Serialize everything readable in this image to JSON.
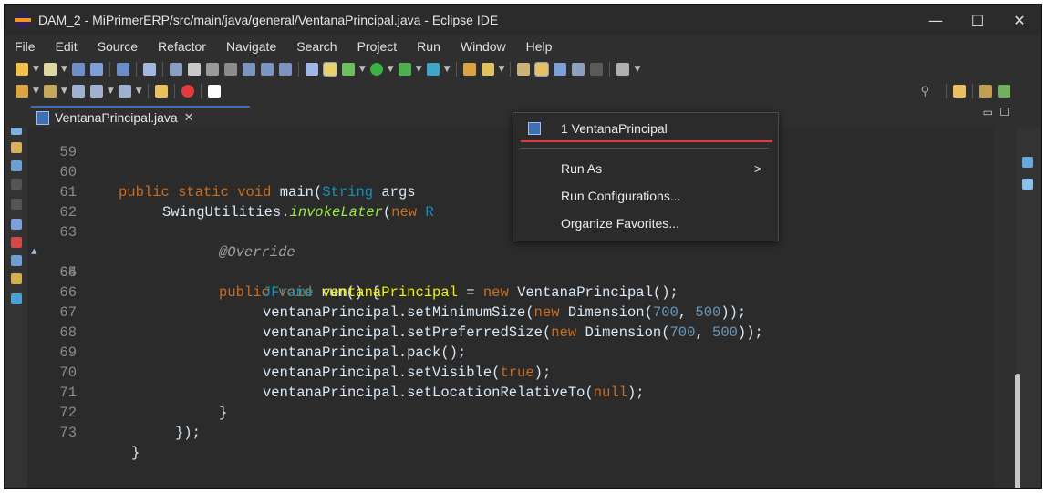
{
  "window": {
    "title": "DAM_2 - MiPrimerERP/src/main/java/general/VentanaPrincipal.java - Eclipse IDE",
    "minimize": "—",
    "maximize": "☐",
    "close": "✕"
  },
  "menubar": [
    "File",
    "Edit",
    "Source",
    "Refactor",
    "Navigate",
    "Search",
    "Project",
    "Run",
    "Window",
    "Help"
  ],
  "editor_tab": {
    "label": "VentanaPrincipal.java",
    "close": "✕"
  },
  "dropdown": {
    "recent_item": "1 VentanaPrincipal",
    "run_as": "Run As",
    "run_as_arrow": ">",
    "run_configurations": "Run Configurations...",
    "organize_favorites": "Organize Favorites..."
  },
  "code_lines": [
    {
      "num": "59",
      "code": ""
    },
    {
      "num": "60",
      "code": "public static void main(String args"
    },
    {
      "num": "61",
      "code": "SwingUtilities.invokeLater(new R"
    },
    {
      "num": "62",
      "code": ""
    },
    {
      "num": "63",
      "code": "@Override"
    },
    {
      "num": "64",
      "code": "public void run() {"
    },
    {
      "num": "65",
      "code": "JFrame ventanaPrincipal = new VentanaPrincipal();"
    },
    {
      "num": "66",
      "code": "ventanaPrincipal.setMinimumSize(new Dimension(700, 500));"
    },
    {
      "num": "67",
      "code": "ventanaPrincipal.setPreferredSize(new Dimension(700, 500));"
    },
    {
      "num": "68",
      "code": "ventanaPrincipal.pack();"
    },
    {
      "num": "69",
      "code": "ventanaPrincipal.setVisible(true);"
    },
    {
      "num": "70",
      "code": "ventanaPrincipal.setLocationRelativeTo(null);"
    },
    {
      "num": "71",
      "code": "}"
    },
    {
      "num": "72",
      "code": "});"
    },
    {
      "num": "73",
      "code": "}"
    }
  ]
}
